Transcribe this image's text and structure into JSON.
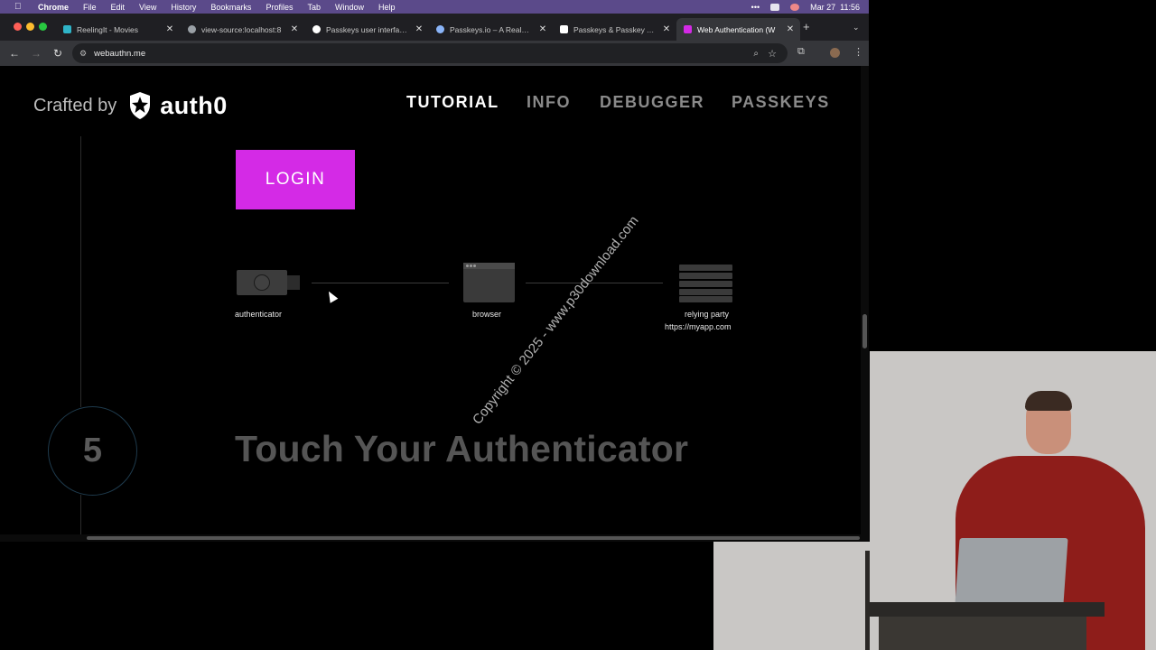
{
  "menubar": {
    "app_name": "Chrome",
    "items": [
      "File",
      "Edit",
      "View",
      "History",
      "Bookmarks",
      "Profiles",
      "Tab",
      "Window",
      "Help"
    ],
    "datetime": "Mar 27  11:56"
  },
  "tabs": [
    {
      "title": "ReelingIt - Movies",
      "favicon_color": "#2fb4c8"
    },
    {
      "title": "view-source:localhost:8",
      "favicon_color": "#9aa0a6"
    },
    {
      "title": "Passkeys user interface",
      "favicon_color": "#ffffff"
    },
    {
      "title": "Passkeys.io – A Real-Wo",
      "favicon_color": "#8ab4f8"
    },
    {
      "title": "Passkeys & Passkey Au",
      "favicon_color": "#ffffff"
    },
    {
      "title": "Web Authentication (W",
      "favicon_color": "#d42ae6",
      "active": true
    }
  ],
  "address_bar": {
    "url": "webauthn.me"
  },
  "site": {
    "crafted_by": "Crafted by",
    "brand": "auth0",
    "nav": [
      {
        "label": "TUTORIAL",
        "active": true
      },
      {
        "label": "INFO"
      },
      {
        "label": "DEBUGGER"
      },
      {
        "label": "PASSKEYS"
      }
    ],
    "login_button": "LOGIN",
    "diagram": {
      "authenticator_label": "authenticator",
      "browser_label": "browser",
      "relying_party_label": "relying party",
      "relying_party_url": "https://myapp.com"
    },
    "watermark": "Copyright © 2025 - www.p30download.com",
    "step": {
      "number": "5",
      "title": "Touch Your Authenticator"
    }
  },
  "colors": {
    "login_accent": "#d42ae6",
    "menubar": "#5b4a8a"
  }
}
